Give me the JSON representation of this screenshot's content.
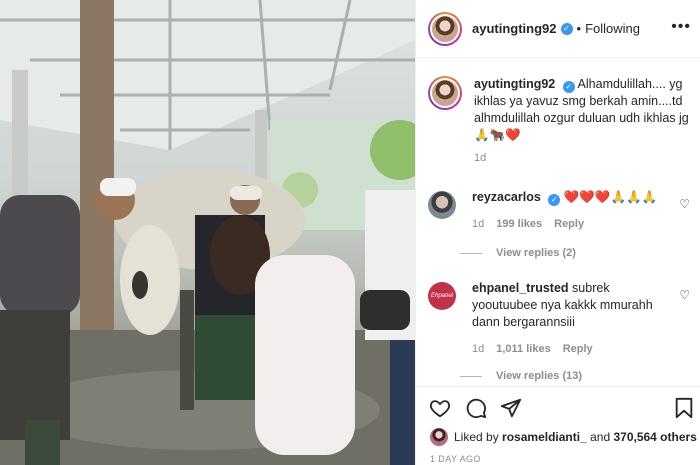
{
  "post": {
    "photo_description_icon": "post-photo"
  },
  "header": {
    "username": "ayutingting92",
    "verified_icon": "verified-badge-icon",
    "separator": "•",
    "follow_status": "Following",
    "more_icon": "more-options-icon",
    "more_label": "•••"
  },
  "caption": {
    "username": "ayutingting92",
    "text": "Alhamdulillah.... yg ikhlas ya yavuz smg berkah amin....td alhmdulillah ozgur duluan udh ikhlas jg 🙏🐂❤️",
    "time": "1d"
  },
  "comments": [
    {
      "username": "reyzacarlos",
      "text": "❤️❤️❤️🙏🙏🙏",
      "time": "1d",
      "likes": "199 likes",
      "reply": "Reply",
      "view_replies": "View replies (2)",
      "avatar_color": "#7a8b95"
    },
    {
      "username": "ehpanel_trusted",
      "text": "subrek yooutuubee nya kakkk mmurahh dann bergarannsiii",
      "time": "1d",
      "likes": "1,011 likes",
      "reply": "Reply",
      "view_replies": "View replies (13)",
      "avatar_color": "#c2304a",
      "avatar_text": "Ehpanel"
    }
  ],
  "actions": {
    "like_icon": "heart-icon",
    "comment_icon": "comment-icon",
    "share_icon": "share-icon",
    "save_icon": "bookmark-icon"
  },
  "likes": {
    "prefix": "Liked by",
    "user": "rosameldianti_",
    "suffix": "and",
    "count": "370,564 others"
  },
  "age": "1 DAY AGO"
}
